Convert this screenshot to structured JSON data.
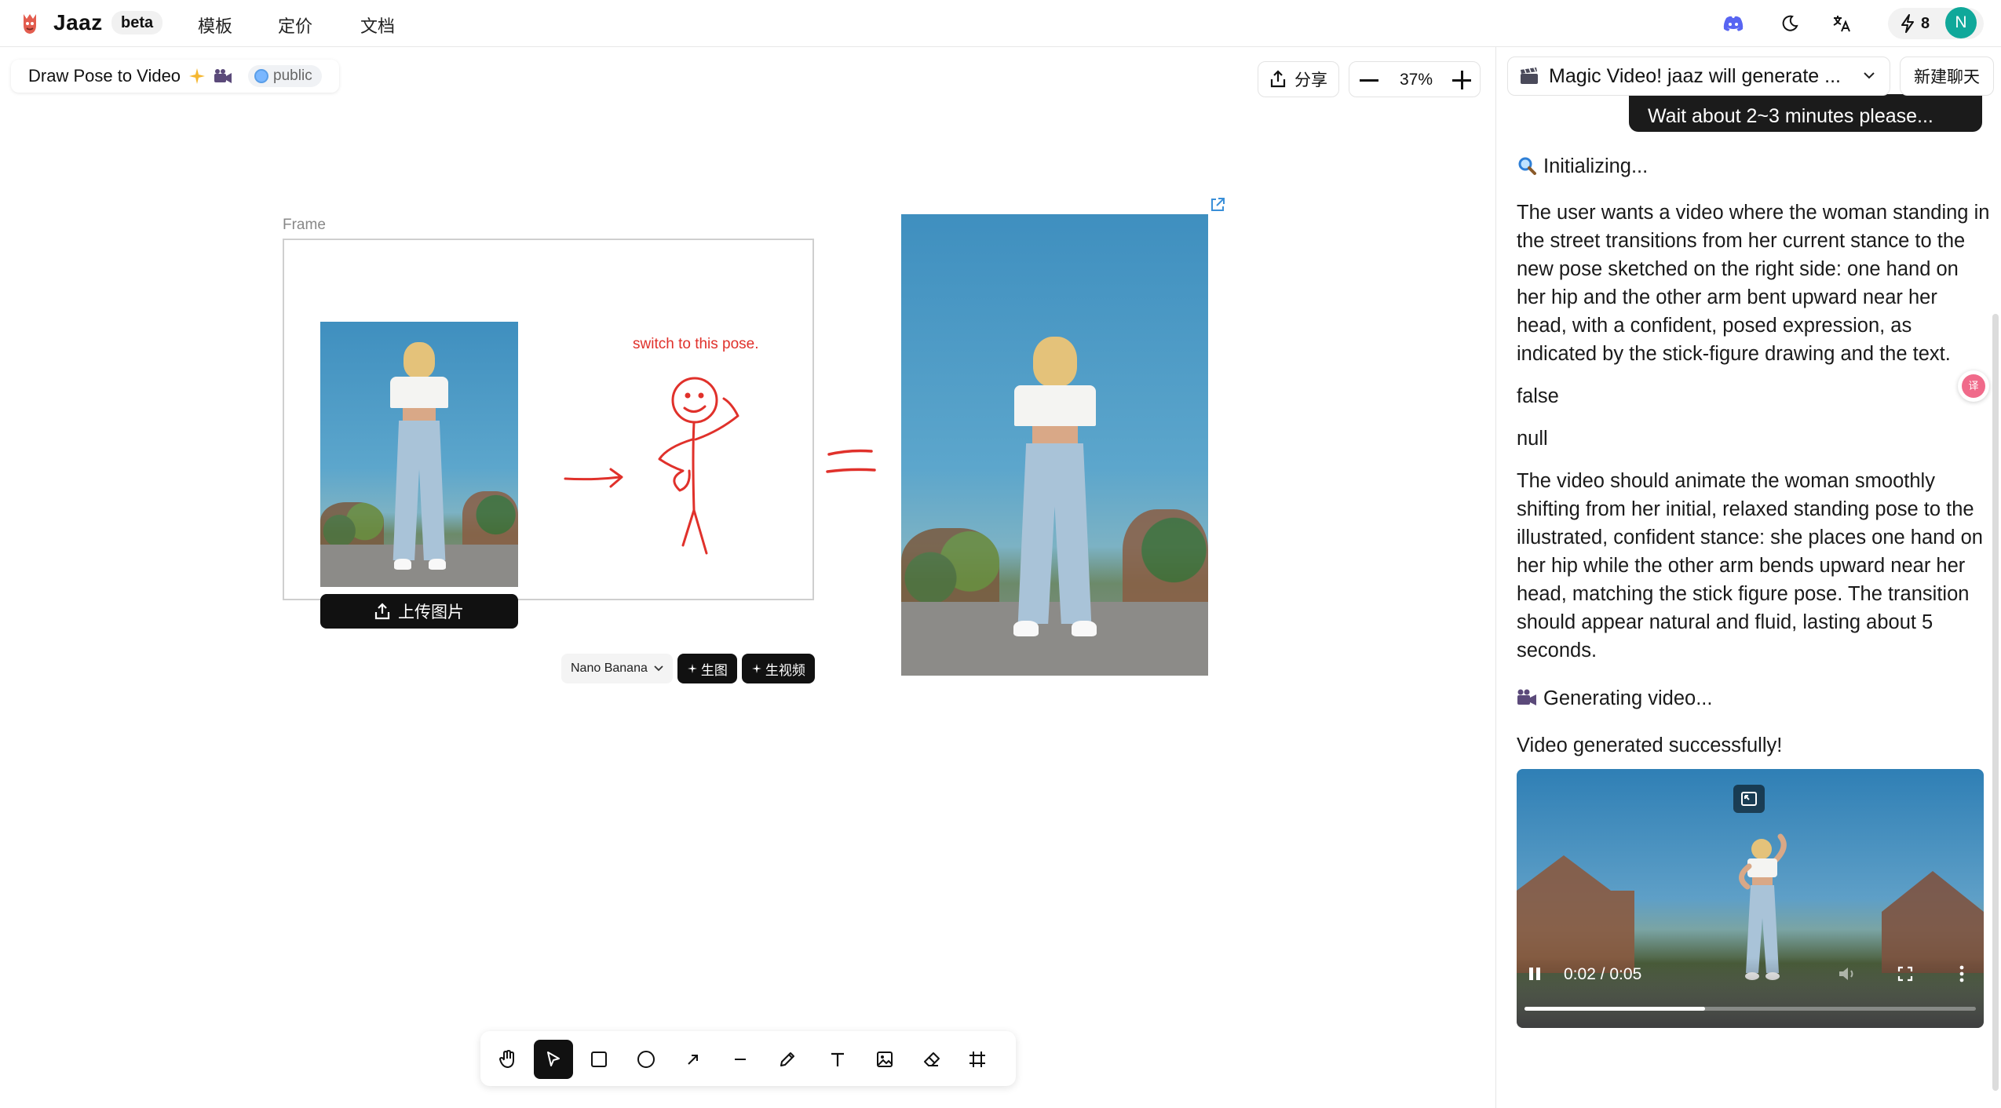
{
  "header": {
    "app_name": "Jaaz",
    "beta_label": "beta",
    "nav": [
      "模板",
      "定价",
      "文档"
    ],
    "credits": "8",
    "avatar_initial": "N",
    "accent_color": "#10a89a"
  },
  "canvas": {
    "project_title": "Draw Pose to Video",
    "visibility": "public",
    "share_label": "分享",
    "zoom": "37%",
    "frame_label": "Frame",
    "upload_label": "上传图片",
    "pose_annotation": "switch to this pose.",
    "model_select": "Nano Banana",
    "gen_image_label": "生图",
    "gen_video_label": "生视频",
    "sketch_color": "#e0312b",
    "tools": [
      "hand-icon",
      "pointer-icon",
      "rectangle-icon",
      "ellipse-icon",
      "arrow-icon",
      "line-icon",
      "pencil-icon",
      "text-icon",
      "image-icon",
      "eraser-icon",
      "frame-icon"
    ],
    "active_tool": "pointer-icon"
  },
  "chat": {
    "session_title": "Magic Video! jaaz will generate ...",
    "new_chat_label": "新建聊天",
    "user_message_tail": "Wait about 2~3 minutes please...",
    "initializing": "Initializing...",
    "reasoning": "The user wants a video where the woman standing in the street transitions from her current stance to the new pose sketched on the right side: one hand on her hip and the other arm bent upward near her head, with a confident, posed expression, as indicated by the stick-figure drawing and the text.",
    "false_text": "false",
    "null_text": "null",
    "video_prompt": "The video should animate the woman smoothly shifting from her initial, relaxed standing pose to the illustrated, confident stance: she places one hand on her hip while the other arm bends upward near her head, matching the stick figure pose. The transition should appear natural and fluid, lasting about 5 seconds.",
    "generating": "Generating video...",
    "success": "Video generated successfully!",
    "video_time": "0:02 / 0:05",
    "video_progress": 0.4
  }
}
